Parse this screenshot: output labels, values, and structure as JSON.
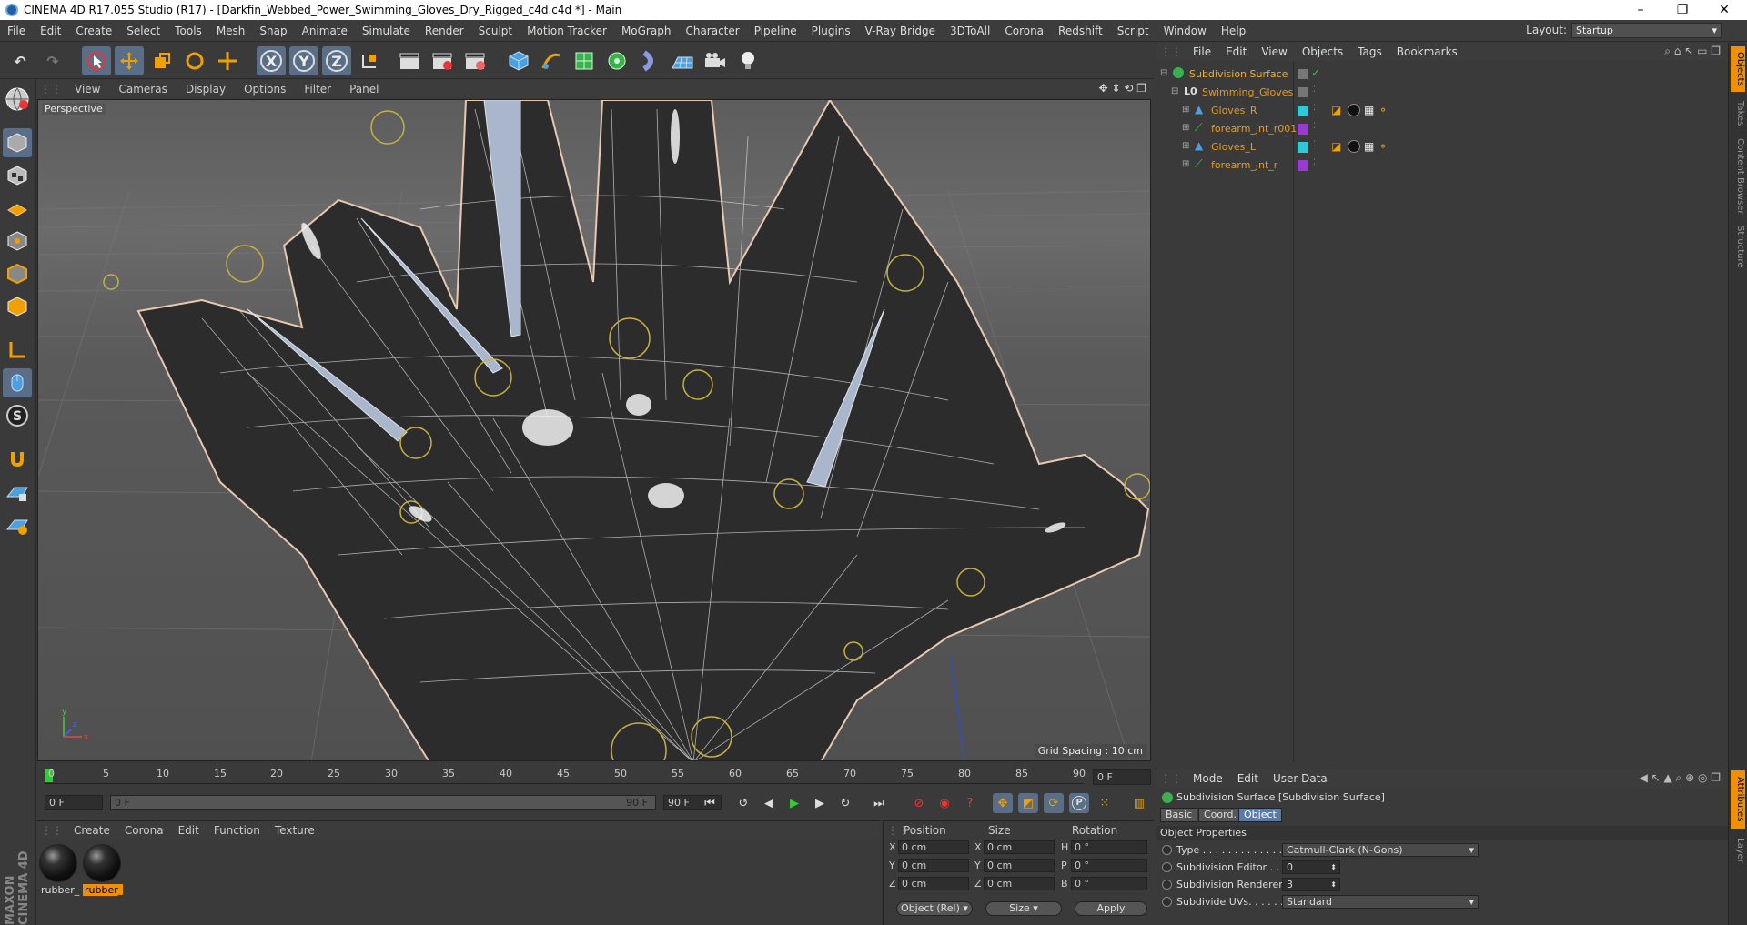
{
  "window": {
    "title": "CINEMA 4D R17.055 Studio (R17) - [Darkfin_Webbed_Power_Swimming_Gloves_Dry_Rigged_c4d.c4d *] - Main",
    "minimize": "–",
    "restore": "❐",
    "close": "✕"
  },
  "menubar": {
    "items": [
      "File",
      "Edit",
      "Create",
      "Select",
      "Tools",
      "Mesh",
      "Snap",
      "Animate",
      "Simulate",
      "Render",
      "Sculpt",
      "Motion Tracker",
      "MoGraph",
      "Character",
      "Pipeline",
      "Plugins",
      "V-Ray Bridge",
      "3DToAll",
      "Corona",
      "Redshift",
      "Script",
      "Window",
      "Help"
    ],
    "layout_label": "Layout:",
    "layout_value": "Startup"
  },
  "toolbar": {
    "axis_x": "X",
    "axis_y": "Y",
    "axis_z": "Z"
  },
  "viewport": {
    "menu": [
      "View",
      "Cameras",
      "Display",
      "Options",
      "Filter",
      "Panel"
    ],
    "camera_label": "Perspective",
    "grid_spacing": "Grid Spacing : 10 cm",
    "axis_y": "y",
    "axis_x": "x",
    "axis_z": "z"
  },
  "timeline": {
    "ticks": [
      "0",
      "5",
      "10",
      "15",
      "20",
      "25",
      "30",
      "35",
      "40",
      "45",
      "50",
      "55",
      "60",
      "65",
      "70",
      "75",
      "80",
      "85",
      "90"
    ],
    "current_frame": "0 F",
    "start_frame": "0 F",
    "range_start": "0 F",
    "range_end": "90 F",
    "end_frame": "90 F",
    "letter_p": "P"
  },
  "material_manager": {
    "menu": [
      "Create",
      "Corona",
      "Edit",
      "Function",
      "Texture"
    ],
    "materials": [
      {
        "label": "rubber_"
      },
      {
        "label": "rubber_"
      }
    ],
    "logo": "MAXON CINEMA 4D"
  },
  "coordinates": {
    "headers": {
      "position": "Position",
      "size": "Size",
      "rotation": "Rotation"
    },
    "rows": [
      {
        "axis": "X",
        "pos": "0 cm",
        "size_axis": "X",
        "size": "0 cm",
        "rot_axis": "H",
        "rot": "0 °"
      },
      {
        "axis": "Y",
        "pos": "0 cm",
        "size_axis": "Y",
        "size": "0 cm",
        "rot_axis": "P",
        "rot": "0 °"
      },
      {
        "axis": "Z",
        "pos": "0 cm",
        "size_axis": "Z",
        "size": "0 cm",
        "rot_axis": "B",
        "rot": "0 °"
      }
    ],
    "mode": "Object (Rel)",
    "size_mode": "Size",
    "apply": "Apply"
  },
  "object_manager": {
    "menu": [
      "File",
      "Edit",
      "View",
      "Objects",
      "Tags",
      "Bookmarks"
    ],
    "objects": [
      {
        "name": "Subdivision Surface"
      },
      {
        "name": "Swimming_Gloves"
      },
      {
        "name": "Gloves_R"
      },
      {
        "name": "forearm_jnt_r001"
      },
      {
        "name": "Gloves_L"
      },
      {
        "name": "forearm_jnt_r"
      }
    ]
  },
  "attribute_manager": {
    "menu": [
      "Mode",
      "Edit",
      "User Data"
    ],
    "object_title": "Subdivision Surface [Subdivision Surface]",
    "tabs": [
      "Basic",
      "Coord.",
      "Object"
    ],
    "section": "Object Properties",
    "props": [
      {
        "label": "Type . . . . . . . . . . . . . .",
        "value": "Catmull-Clark (N-Gons)"
      },
      {
        "label": "Subdivision Editor . .",
        "value": "0"
      },
      {
        "label": "Subdivision Renderer",
        "value": "3"
      },
      {
        "label": "Subdivide UVs. . . . . .",
        "value": "Standard"
      }
    ]
  },
  "right_tabs": [
    "Objects",
    "Takes",
    "Content Browser",
    "Structure",
    "Attributes",
    "Layer"
  ],
  "colors": {
    "accent_orange": "#f09000",
    "object_name": "#e89a1a",
    "tag_cyan": "#2fc8d8",
    "tag_purple": "#9a3ad0",
    "selection_blue": "#5a7aa8"
  }
}
